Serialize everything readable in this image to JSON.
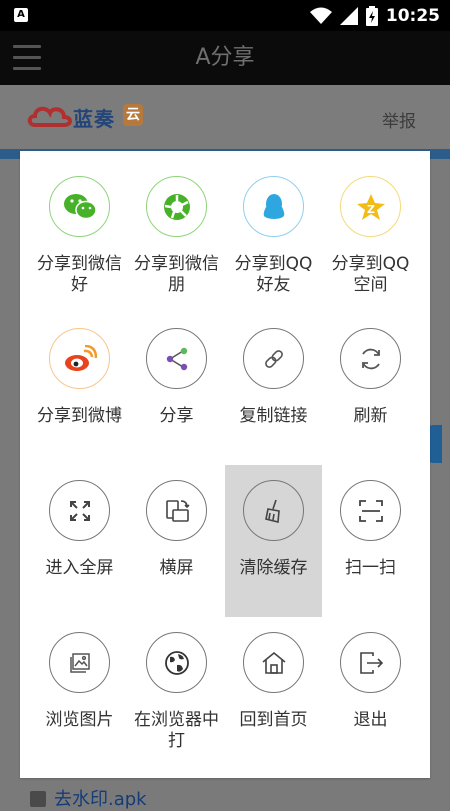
{
  "status_bar": {
    "app_icon": "A",
    "time": "10:25",
    "icons": [
      "wifi-icon",
      "cell-signal-icon",
      "battery-charging-icon"
    ]
  },
  "app_bar": {
    "title": "A分享",
    "menu_icon": "hamburger-menu-icon"
  },
  "web_page": {
    "logo_text": "蓝奏",
    "logo_badge": "云",
    "report_link": "举报",
    "file_name": "去水印.apk"
  },
  "share_menu": {
    "items": [
      {
        "label": "分享到微信好",
        "icon": "wechat-icon"
      },
      {
        "label": "分享到微信朋",
        "icon": "moments-icon"
      },
      {
        "label": "分享到QQ好友",
        "icon": "qq-icon"
      },
      {
        "label": "分享到QQ空间",
        "icon": "qzone-icon"
      },
      {
        "label": "分享到微博",
        "icon": "weibo-icon"
      },
      {
        "label": "分享",
        "icon": "share-icon"
      },
      {
        "label": "复制链接",
        "icon": "link-icon"
      },
      {
        "label": "刷新",
        "icon": "refresh-icon"
      },
      {
        "label": "进入全屏",
        "icon": "fullscreen-icon"
      },
      {
        "label": "横屏",
        "icon": "rotate-screen-icon"
      },
      {
        "label": "清除缓存",
        "icon": "broom-icon"
      },
      {
        "label": "扫一扫",
        "icon": "scan-icon"
      },
      {
        "label": "浏览图片",
        "icon": "image-icon"
      },
      {
        "label": "在浏览器中打",
        "icon": "globe-icon"
      },
      {
        "label": "回到首页",
        "icon": "home-icon"
      },
      {
        "label": "退出",
        "icon": "exit-icon"
      }
    ],
    "selected_item": "清除缓存"
  },
  "colors": {
    "wechat_green": "#48b12a",
    "qq_blue": "#2ea7e0",
    "qzone_yellow": "#f2bb16",
    "weibo_orange": "#f39a2c",
    "selected_bg": "#d6d6d6"
  }
}
